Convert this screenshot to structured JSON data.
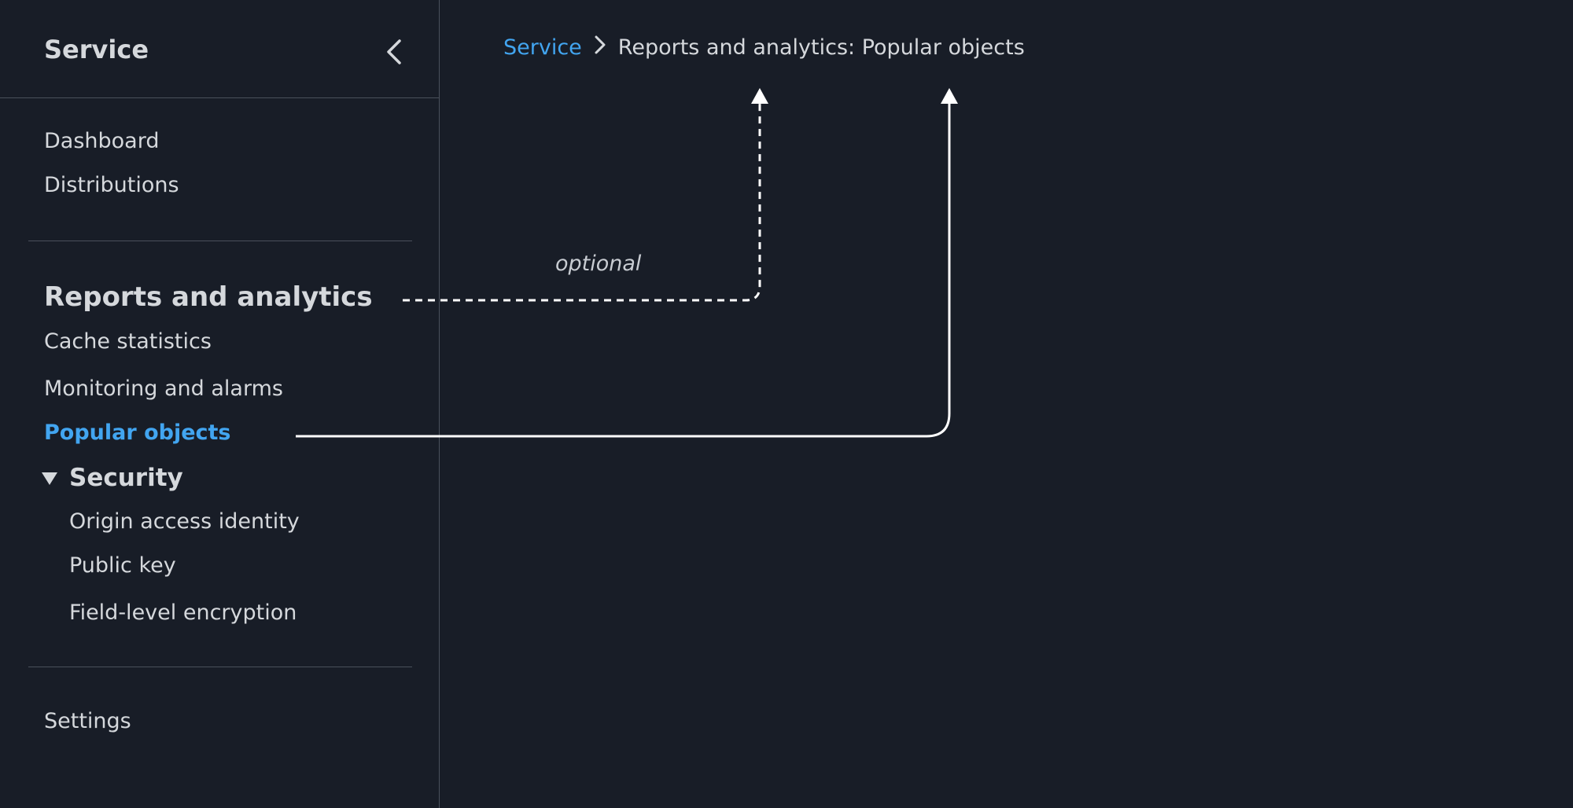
{
  "sidebar": {
    "title": "Service",
    "collapse_icon": "chevron-left-icon",
    "top_items": [
      {
        "label": "Dashboard"
      },
      {
        "label": "Distributions"
      }
    ],
    "section_title": "Reports and analytics",
    "report_items": [
      {
        "label": "Cache statistics"
      },
      {
        "label": "Monitoring and alarms"
      },
      {
        "label": "Popular objects",
        "active": true
      }
    ],
    "security": {
      "label": "Security",
      "expanded": true,
      "caret_icon": "caret-down-icon",
      "items": [
        {
          "label": "Origin access identity"
        },
        {
          "label": "Public key"
        },
        {
          "label": "Field-level encryption"
        }
      ]
    },
    "bottom_items": [
      {
        "label": "Settings"
      }
    ]
  },
  "breadcrumb": {
    "root": "Service",
    "separator_icon": "chevron-right-icon",
    "current": "Reports and analytics: Popular objects"
  },
  "annotations": {
    "optional_label": "optional"
  },
  "colors": {
    "background": "#181d27",
    "text": "#d5d8dc",
    "link": "#42a5f0",
    "divider": "#4a505b",
    "arrow": "#ffffff"
  }
}
